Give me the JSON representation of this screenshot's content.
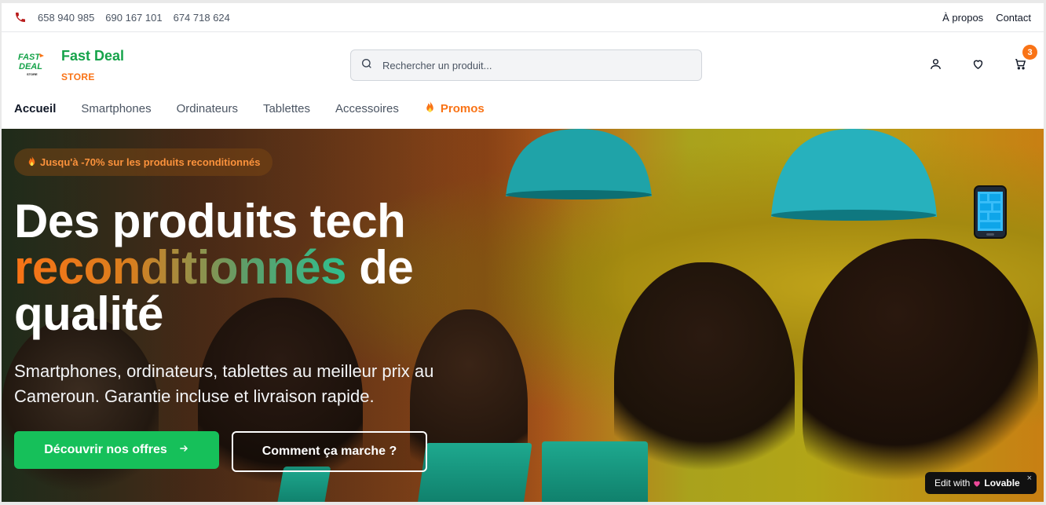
{
  "topbar": {
    "phones": [
      "658 940 985",
      "690 167 101",
      "674 718 624"
    ],
    "links": [
      "À propos",
      "Contact"
    ]
  },
  "brand": {
    "logo_text_1": "FAST",
    "logo_text_2": "DEAL",
    "logo_text_3": "STORE",
    "name": "Fast Deal",
    "sub": "STORE"
  },
  "search": {
    "placeholder": "Rechercher un produit..."
  },
  "header": {
    "cart_count": "3"
  },
  "nav": {
    "items": [
      "Accueil",
      "Smartphones",
      "Ordinateurs",
      "Tablettes",
      "Accessoires"
    ],
    "promo": "Promos"
  },
  "hero": {
    "badge": "Jusqu'à -70% sur les produits reconditionnés",
    "title_line1": "Des produits tech",
    "title_highlight": "reconditionnés",
    "title_after": "de",
    "title_line3": "qualité",
    "lead": "Smartphones, ordinateurs, tablettes au meilleur prix au Cameroun. Garantie incluse et livraison rapide.",
    "primary_cta": "Découvrir nos offres",
    "secondary_cta": "Comment ça marche ?"
  },
  "lovable_badge": {
    "prefix": "Edit with",
    "brand": "Lovable",
    "close": "×"
  },
  "colors": {
    "brand_green": "#16a34a",
    "brand_orange": "#f97316",
    "cta_green": "#16c05a"
  },
  "icons": [
    "phone-icon",
    "search-icon",
    "user-icon",
    "heart-icon",
    "cart-icon",
    "fire-icon",
    "arrow-right-icon",
    "mobile-phone-icon",
    "lovable-heart-icon",
    "close-icon"
  ]
}
